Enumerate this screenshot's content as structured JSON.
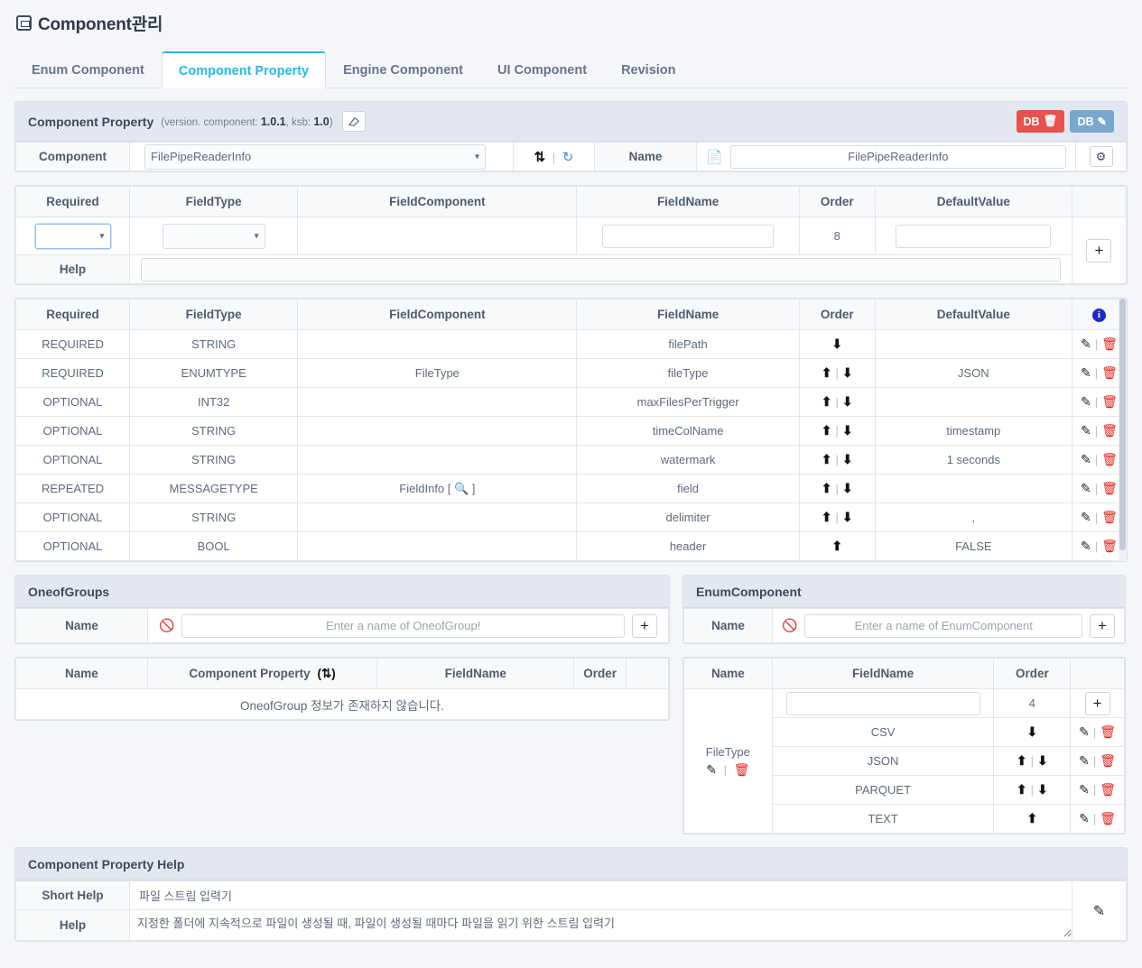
{
  "page": {
    "title": "Component관리",
    "title_icon": "window-icon"
  },
  "tabs": [
    {
      "label": "Enum Component",
      "active": false
    },
    {
      "label": "Component Property",
      "active": true
    },
    {
      "label": "Engine Component",
      "active": false
    },
    {
      "label": "UI Component",
      "active": false
    },
    {
      "label": "Revision",
      "active": false
    }
  ],
  "component_property_panel": {
    "title": "Component Property",
    "version_prefix": "(version. component:",
    "version_component": "1.0.1",
    "version_ksb_label": ", ksb:",
    "version_ksb": "1.0",
    "version_suffix": ")",
    "eraser_icon": "eraser-icon",
    "db_delete_label": "DB",
    "db_edit_label": "DB",
    "component_label": "Component",
    "component_value": "FilePipeReaderInfo",
    "refresh_icon": "refresh-icon",
    "history_icon": "history-icon",
    "name_label": "Name",
    "name_value": "FilePipeReaderInfo",
    "settings_icon": "gear-icon",
    "file_icon": "file-icon"
  },
  "input_form": {
    "headers": [
      "Required",
      "FieldType",
      "FieldComponent",
      "FieldName",
      "Order",
      "DefaultValue"
    ],
    "required_value": "",
    "fieldtype_value": "",
    "fieldcomponent_value": "",
    "fieldname_value": "",
    "order_value": "8",
    "defaultvalue_value": "",
    "add_label": "+",
    "help_label": "Help",
    "help_value": ""
  },
  "property_table": {
    "headers": [
      "Required",
      "FieldType",
      "FieldComponent",
      "FieldName",
      "Order",
      "DefaultValue"
    ],
    "info_icon": "info-icon",
    "rows": [
      {
        "required": "REQUIRED",
        "fieldtype": "STRING",
        "fieldcomponent": "",
        "fieldcomponent_search": false,
        "fieldname": "filePath",
        "order": "down",
        "defaultvalue": ""
      },
      {
        "required": "REQUIRED",
        "fieldtype": "ENUMTYPE",
        "fieldcomponent": "FileType",
        "fieldcomponent_search": false,
        "fieldname": "fileType",
        "order": "both",
        "defaultvalue": "JSON"
      },
      {
        "required": "OPTIONAL",
        "fieldtype": "INT32",
        "fieldcomponent": "",
        "fieldcomponent_search": false,
        "fieldname": "maxFilesPerTrigger",
        "order": "both",
        "defaultvalue": ""
      },
      {
        "required": "OPTIONAL",
        "fieldtype": "STRING",
        "fieldcomponent": "",
        "fieldcomponent_search": false,
        "fieldname": "timeColName",
        "order": "both",
        "defaultvalue": "timestamp"
      },
      {
        "required": "OPTIONAL",
        "fieldtype": "STRING",
        "fieldcomponent": "",
        "fieldcomponent_search": false,
        "fieldname": "watermark",
        "order": "both",
        "defaultvalue": "1 seconds"
      },
      {
        "required": "REPEATED",
        "fieldtype": "MESSAGETYPE",
        "fieldcomponent": "FieldInfo",
        "fieldcomponent_search": true,
        "fieldname": "field",
        "order": "both",
        "defaultvalue": ""
      },
      {
        "required": "OPTIONAL",
        "fieldtype": "STRING",
        "fieldcomponent": "",
        "fieldcomponent_search": false,
        "fieldname": "delimiter",
        "order": "both",
        "defaultvalue": ","
      },
      {
        "required": "OPTIONAL",
        "fieldtype": "BOOL",
        "fieldcomponent": "",
        "fieldcomponent_search": false,
        "fieldname": "header",
        "order": "up",
        "defaultvalue": "FALSE"
      }
    ]
  },
  "oneof_groups": {
    "title": "OneofGroups",
    "name_label": "Name",
    "name_placeholder": "Enter a name of OneofGroup!",
    "name_value": "",
    "add_label": "+",
    "ban_icon": "ban-icon",
    "table_headers": [
      "Name",
      "Component Property",
      "FieldName",
      "Order"
    ],
    "refresh_icon": "refresh-icon",
    "empty_message": "OneofGroup 정보가 존재하지 않습니다."
  },
  "enum_component": {
    "title": "EnumComponent",
    "name_label": "Name",
    "name_placeholder": "Enter a name of EnumComponent",
    "name_value": "",
    "add_label": "+",
    "ban_icon": "ban-icon",
    "table_headers": [
      "Name",
      "FieldName",
      "Order"
    ],
    "group_name": "FileType",
    "new_fieldname_value": "",
    "new_order_value": "4",
    "rows": [
      {
        "fieldname": "CSV",
        "order": "down"
      },
      {
        "fieldname": "JSON",
        "order": "both"
      },
      {
        "fieldname": "PARQUET",
        "order": "both"
      },
      {
        "fieldname": "TEXT",
        "order": "up"
      }
    ]
  },
  "help_panel": {
    "title": "Component Property Help",
    "short_help_label": "Short Help",
    "short_help_value": "파일 스트림 입력기",
    "help_label": "Help",
    "help_value": "지정한 폴더에 지속적으로 파일이 생성될 때, 파일이 생성될 때마다 파일을 읽기 위한 스트림 입력기",
    "edit_icon": "edit-icon"
  },
  "colors": {
    "accent": "#25b9e8",
    "danger": "#e8524c",
    "info": "#79a8cf",
    "header_bg": "#e3e8f0"
  }
}
